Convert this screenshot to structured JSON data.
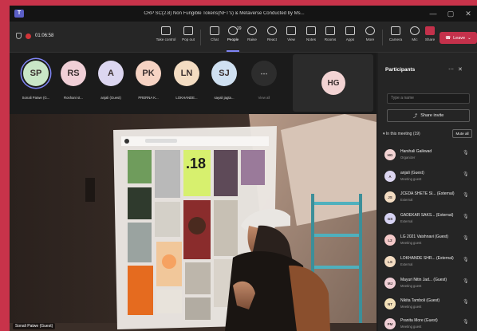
{
  "window": {
    "title": "CRP SC(2.8) Non Fungible Tokens(NFT's) & Metaverse Conducted by Ms...",
    "controls": [
      "—",
      "▢",
      "✕"
    ]
  },
  "toolbar": {
    "timer": "01:06:58",
    "buttons": [
      {
        "id": "take-control",
        "label": "Take control"
      },
      {
        "id": "pop-out",
        "label": "Pop out"
      },
      {
        "id": "chat",
        "label": "Chat"
      },
      {
        "id": "people",
        "label": "People",
        "count": "19",
        "active": true
      },
      {
        "id": "raise",
        "label": "Raise"
      },
      {
        "id": "react",
        "label": "React"
      },
      {
        "id": "view",
        "label": "View"
      },
      {
        "id": "notes",
        "label": "Notes"
      },
      {
        "id": "rooms",
        "label": "Rooms"
      },
      {
        "id": "apps",
        "label": "Apps"
      },
      {
        "id": "more",
        "label": "More"
      },
      {
        "id": "camera",
        "label": "Camera"
      },
      {
        "id": "mic",
        "label": "Mic"
      },
      {
        "id": "share",
        "label": "Share"
      }
    ],
    "leave_label": "Leave"
  },
  "stage": {
    "avatars": [
      {
        "initials": "SP",
        "name": "Sonali Patwe (G...",
        "color": "#c9e6c7",
        "highlight": true
      },
      {
        "initials": "RS",
        "name": "Roshani st...",
        "color": "#f0cfd6"
      },
      {
        "initials": "A",
        "name": "anjali (Guest)",
        "color": "#dcd6f0"
      },
      {
        "initials": "PK",
        "name": "PRERNA K...",
        "color": "#f6d3c3"
      },
      {
        "initials": "LN",
        "name": "LOKHANDE...",
        "color": "#f3dcc2"
      },
      {
        "initials": "SJ",
        "name": "sayali jagta...",
        "color": "#cfe0f1"
      },
      {
        "initials": "⋯",
        "name": "View all",
        "more": true
      }
    ],
    "spotlight_initials": "HG",
    "video_caption": "Sonali Patwe (Guest)"
  },
  "panel": {
    "title": "Participants",
    "search_placeholder": "Type a name",
    "share_invite": "Share invite",
    "in_meeting": "In this meeting (19)",
    "mute_all": "Mute all",
    "participants": [
      {
        "initials": "HG",
        "name": "Harshali Gaikwad",
        "role": "Organizer",
        "color": "#f2d3d3"
      },
      {
        "initials": "A",
        "name": "anjali (Guest)",
        "role": "Meeting guest",
        "color": "#dcd6f0"
      },
      {
        "initials": "JS",
        "name": "JCEDA SHETE SI...  (External)",
        "role": "External",
        "color": "#f3dcc2"
      },
      {
        "initials": "GS",
        "name": "GADEKAR SAKS...  (External)",
        "role": "External",
        "color": "#d6d3f3"
      },
      {
        "initials": "L2",
        "name": "LG 2021 Vaishnavi (Guest)",
        "role": "Meeting guest",
        "color": "#f4c9c9"
      },
      {
        "initials": "LS",
        "name": "LOKHANDE SHR...  (External)",
        "role": "External",
        "color": "#f3dcc2"
      },
      {
        "initials": "MJ",
        "name": "Mayuri Nitin Jad...  (Guest)",
        "role": "Meeting guest",
        "color": "#f0cfd6"
      },
      {
        "initials": "NT",
        "name": "Nikita Tamboli (Guest)",
        "role": "Meeting guest",
        "color": "#f3e0b8"
      },
      {
        "initials": "PM",
        "name": "Pranita More (Guest)",
        "role": "Meeting guest",
        "color": "#f0cfd6"
      }
    ]
  },
  "shared_screen": {
    "card_number": ".18"
  }
}
